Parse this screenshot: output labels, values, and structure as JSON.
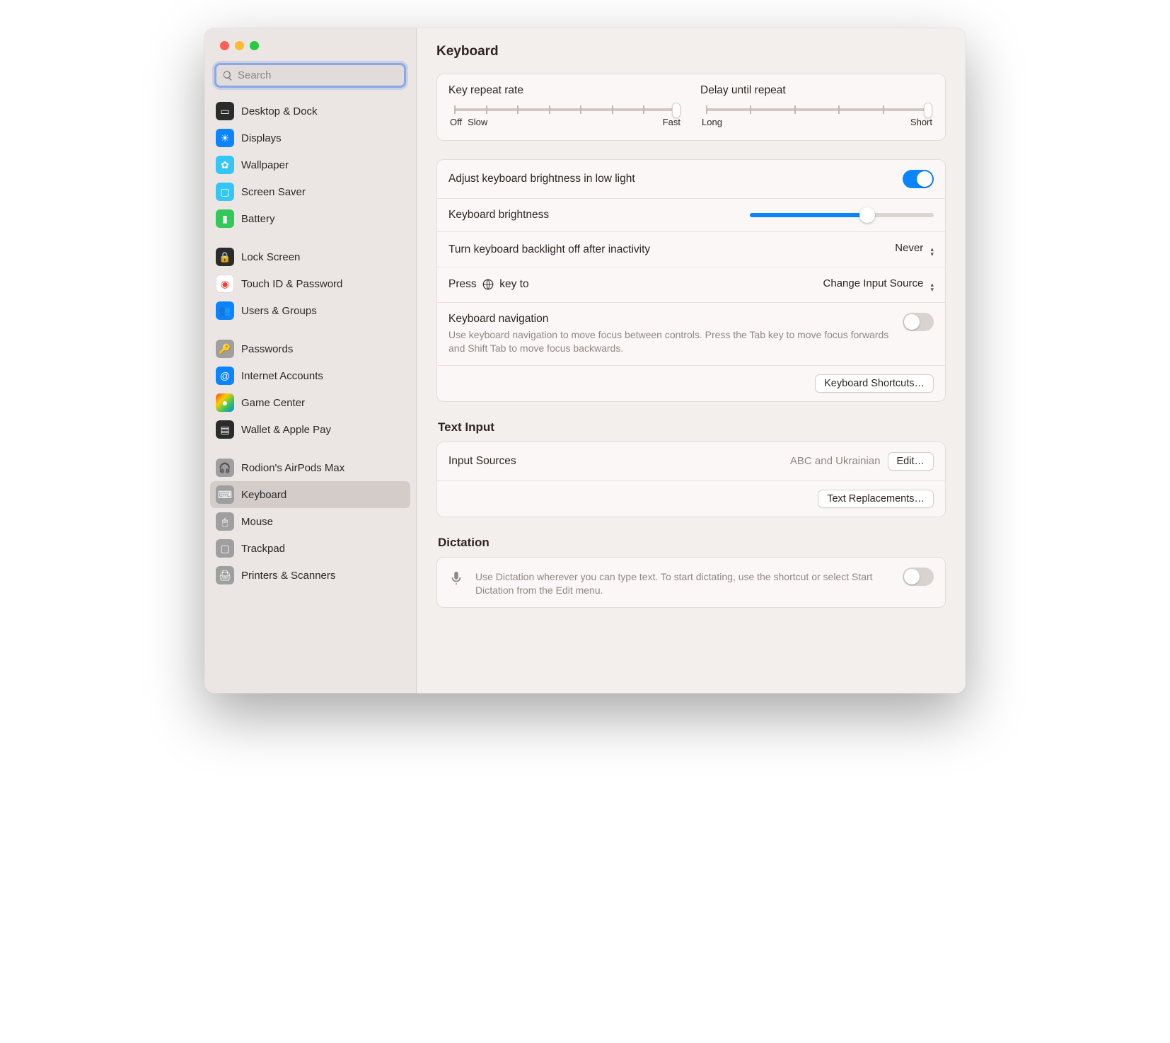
{
  "search": {
    "placeholder": "Search"
  },
  "page_title": "Keyboard",
  "sidebar": {
    "items": [
      {
        "label": "Desktop & Dock"
      },
      {
        "label": "Displays"
      },
      {
        "label": "Wallpaper"
      },
      {
        "label": "Screen Saver"
      },
      {
        "label": "Battery"
      },
      {
        "label": "Lock Screen"
      },
      {
        "label": "Touch ID & Password"
      },
      {
        "label": "Users & Groups"
      },
      {
        "label": "Passwords"
      },
      {
        "label": "Internet Accounts"
      },
      {
        "label": "Game Center"
      },
      {
        "label": "Wallet & Apple Pay"
      },
      {
        "label": "Rodion's AirPods Max"
      },
      {
        "label": "Keyboard"
      },
      {
        "label": "Mouse"
      },
      {
        "label": "Trackpad"
      },
      {
        "label": "Printers & Scanners"
      }
    ]
  },
  "key_repeat": {
    "title": "Key repeat rate",
    "left": "Off",
    "mid": "Slow",
    "right": "Fast"
  },
  "delay_repeat": {
    "title": "Delay until repeat",
    "left": "Long",
    "right": "Short"
  },
  "brightness": {
    "adjust_label": "Adjust keyboard brightness in low light",
    "kb_brightness_label": "Keyboard brightness",
    "backlight_off_label": "Turn keyboard backlight off after inactivity",
    "backlight_off_value": "Never",
    "press_key_prefix": "Press ",
    "press_key_suffix": " key to",
    "press_key_value": "Change Input Source",
    "kb_nav_label": "Keyboard navigation",
    "kb_nav_sub": "Use keyboard navigation to move focus between controls. Press the Tab key to move focus forwards and Shift Tab to move focus backwards.",
    "shortcuts_btn": "Keyboard Shortcuts…"
  },
  "text_input": {
    "section": "Text Input",
    "input_sources_label": "Input Sources",
    "input_sources_value": "ABC and Ukrainian",
    "edit_btn": "Edit…",
    "replacements_btn": "Text Replacements…"
  },
  "dictation": {
    "section": "Dictation",
    "desc": "Use Dictation wherever you can type text. To start dictating, use the shortcut or select Start Dictation from the Edit menu."
  }
}
